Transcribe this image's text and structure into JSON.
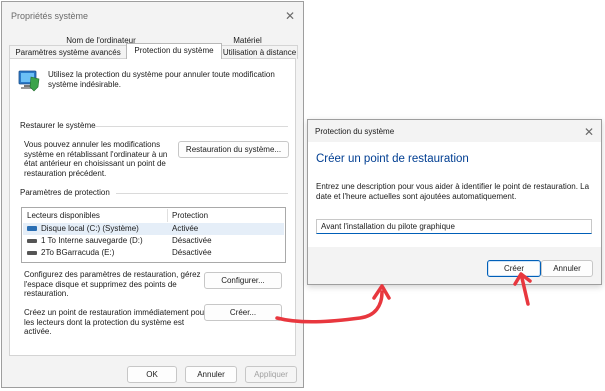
{
  "system_properties": {
    "title": "Propriétés système",
    "tabs_row1": [
      "Nom de l'ordinateur",
      "Matériel"
    ],
    "tabs_row2": [
      "Paramètres système avancés",
      "Protection du système",
      "Utilisation à distance"
    ],
    "intro_text": "Utilisez la protection du système pour annuler toute modification système indésirable.",
    "restore_section_label": "Restaurer le système",
    "restore_description": "Vous pouvez annuler les modifications système en rétablissant l'ordinateur à un état antérieur en choisissant un point de restauration précédent.",
    "restore_button": "Restauration du système...",
    "protection_section_label": "Paramètres de protection",
    "list_headers": [
      "Lecteurs disponibles",
      "Protection"
    ],
    "drives": [
      {
        "name": "Disque local (C:) (Système)",
        "status": "Activée",
        "icon": "system-drive-icon"
      },
      {
        "name": "1 To Interne sauvegarde (D:)",
        "status": "Désactivée",
        "icon": "drive-icon"
      },
      {
        "name": "2To BGarracuda (E:)",
        "status": "Désactivée",
        "icon": "drive-icon"
      }
    ],
    "configure_text": "Configurez des paramètres de restauration, gérez l'espace disque et supprimez des points de restauration.",
    "configure_button": "Configurer...",
    "create_text": "Créez un point de restauration immédiatement pour les lecteurs dont la protection du système est activée.",
    "create_button": "Créer...",
    "ok_button": "OK",
    "cancel_button": "Annuler",
    "apply_button": "Appliquer"
  },
  "create_dialog": {
    "title": "Protection du système",
    "heading": "Créer un point de restauration",
    "description": "Entrez une description pour vous aider à identifier le point de restauration. La date et l'heure actuelles sont ajoutées automatiquement.",
    "input_value": "Avant l'installation du pilote graphique",
    "create_button": "Créer",
    "cancel_button": "Annuler"
  },
  "colors": {
    "accent": "#005fb8",
    "annotation_arrow": "#e8373e",
    "heading": "#003e92"
  }
}
